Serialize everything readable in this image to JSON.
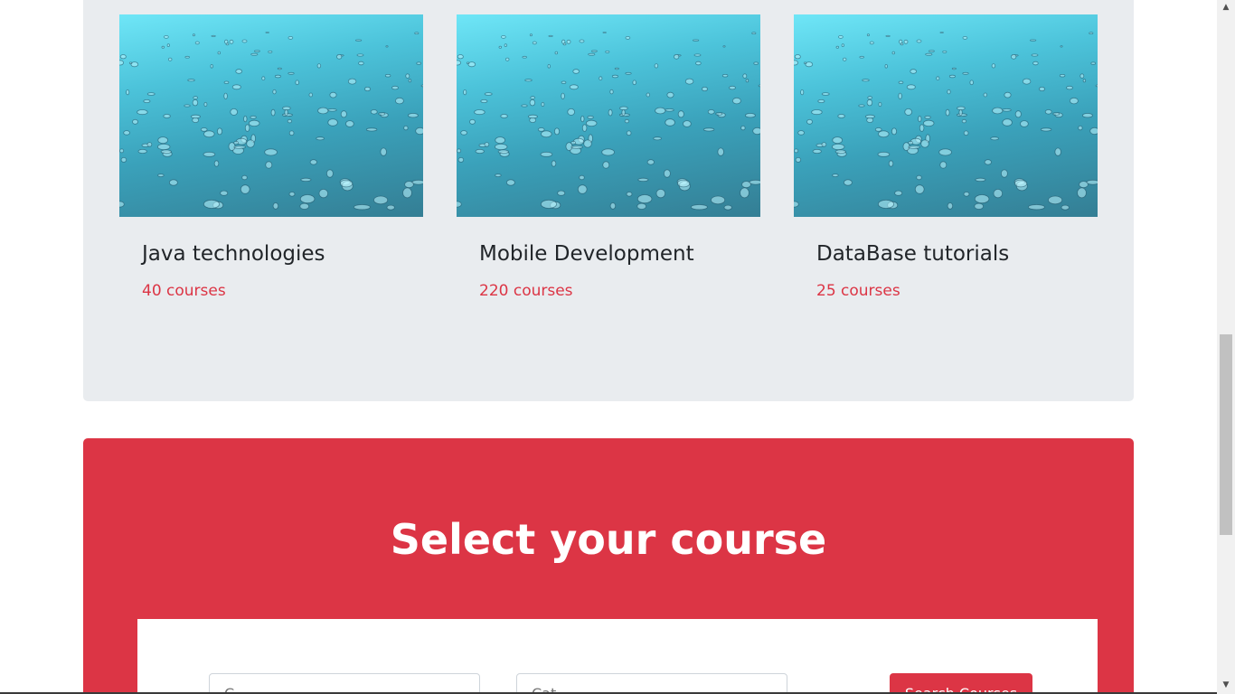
{
  "categories": [
    {
      "title": "Java technologies",
      "count": "40 courses",
      "image": "water-droplets-image"
    },
    {
      "title": "Mobile Development",
      "count": "220 courses",
      "image": "water-droplets-image"
    },
    {
      "title": "DataBase tutorials",
      "count": "25 courses",
      "image": "water-droplets-image"
    }
  ],
  "select_section": {
    "title": "Select your course",
    "course_placeholder": "C...",
    "category_placeholder": "Cat...",
    "search_label": "Search Courses"
  },
  "colors": {
    "accent": "#dc3545",
    "panel_bg": "#e9ecef",
    "heading_text": "#212529"
  },
  "icons": {
    "scroll_up": "scroll-up-arrow-icon",
    "scroll_down": "scroll-down-arrow-icon"
  }
}
